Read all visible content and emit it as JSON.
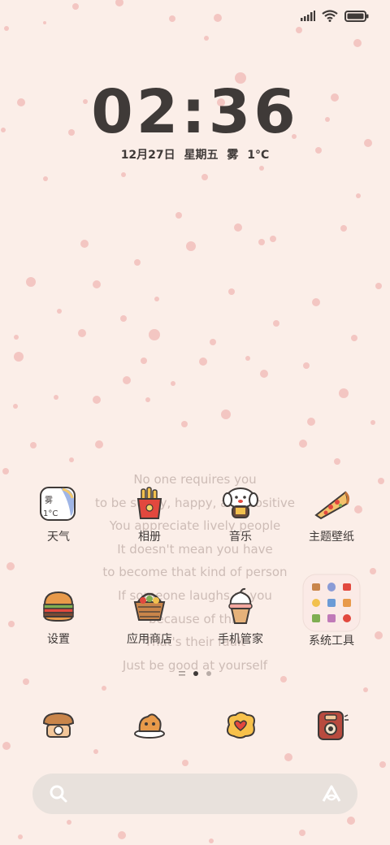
{
  "clock": {
    "time": "02:36",
    "date": "12月27日  星期五  雾  1°C"
  },
  "weather_widget": {
    "condition": "雾",
    "temp": "1°C"
  },
  "poem": [
    "No one requires you",
    "to be sunny, happy, and positive",
    "You appreciate lively people",
    "It doesn't mean you have",
    "to become that kind of person",
    "If someone laughs at you",
    "because of this",
    "That's their fault",
    "Just be good at yourself"
  ],
  "apps": [
    {
      "label": "天气",
      "icon": "weather-icon"
    },
    {
      "label": "相册",
      "icon": "gallery-icon"
    },
    {
      "label": "音乐",
      "icon": "music-icon"
    },
    {
      "label": "主题壁纸",
      "icon": "themes-icon"
    },
    {
      "label": "设置",
      "icon": "settings-icon"
    },
    {
      "label": "应用商店",
      "icon": "app-store-icon"
    },
    {
      "label": "手机管家",
      "icon": "security-icon"
    },
    {
      "label": "系统工具",
      "icon": "system-tools-folder-icon"
    }
  ],
  "dock": [
    {
      "icon": "phone-icon"
    },
    {
      "icon": "messages-icon"
    },
    {
      "icon": "browser-icon"
    },
    {
      "icon": "camera-icon"
    }
  ],
  "page_indicator": {
    "pages": 2,
    "current": 1
  },
  "colors": {
    "background": "#fbeee8",
    "text": "#3f3a38",
    "speckle": "#f1b9b6"
  }
}
